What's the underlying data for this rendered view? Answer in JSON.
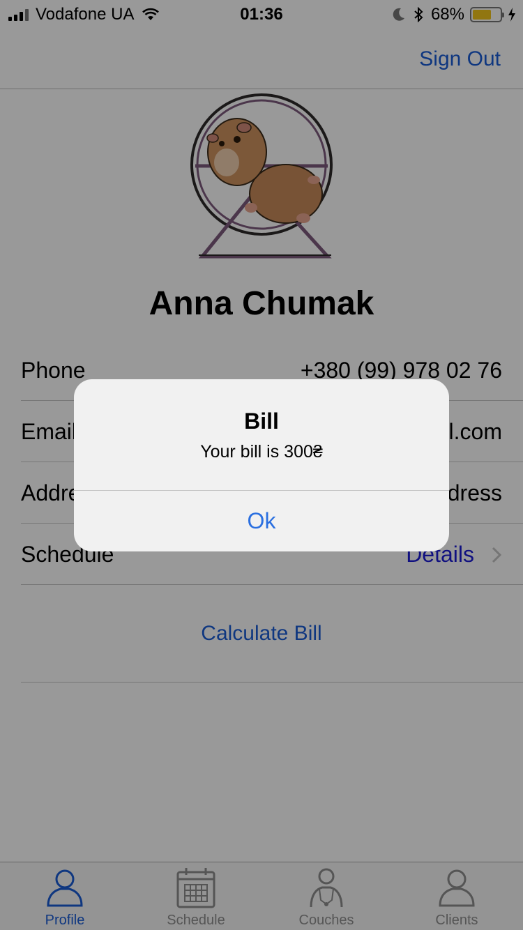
{
  "status_bar": {
    "carrier": "Vodafone UA",
    "time": "01:36",
    "battery_percent": "68%",
    "battery_level": 0.68
  },
  "nav": {
    "sign_out": "Sign Out"
  },
  "profile": {
    "name": "Anna Chumak",
    "rows": [
      {
        "label": "Phone",
        "value": "+380 (99) 978 02 76"
      },
      {
        "label": "Email",
        "value": "anna.chumak@gmail.com"
      },
      {
        "label": "Address",
        "value": "No address"
      },
      {
        "label": "Schedule",
        "value": "Details"
      }
    ],
    "calculate_bill": "Calculate Bill"
  },
  "tabs": [
    {
      "label": "Profile",
      "icon": "person-icon",
      "active": true
    },
    {
      "label": "Schedule",
      "icon": "calendar-icon",
      "active": false
    },
    {
      "label": "Couches",
      "icon": "coach-icon",
      "active": false
    },
    {
      "label": "Clients",
      "icon": "person-icon",
      "active": false
    }
  ],
  "alert": {
    "title": "Bill",
    "message": "Your bill is 300₴",
    "ok": "Ok"
  },
  "colors": {
    "accent": "#1a5cd6",
    "battery": "#f2c51b",
    "details_link": "#1c1cd6",
    "alert_button": "#2a6fe0"
  }
}
